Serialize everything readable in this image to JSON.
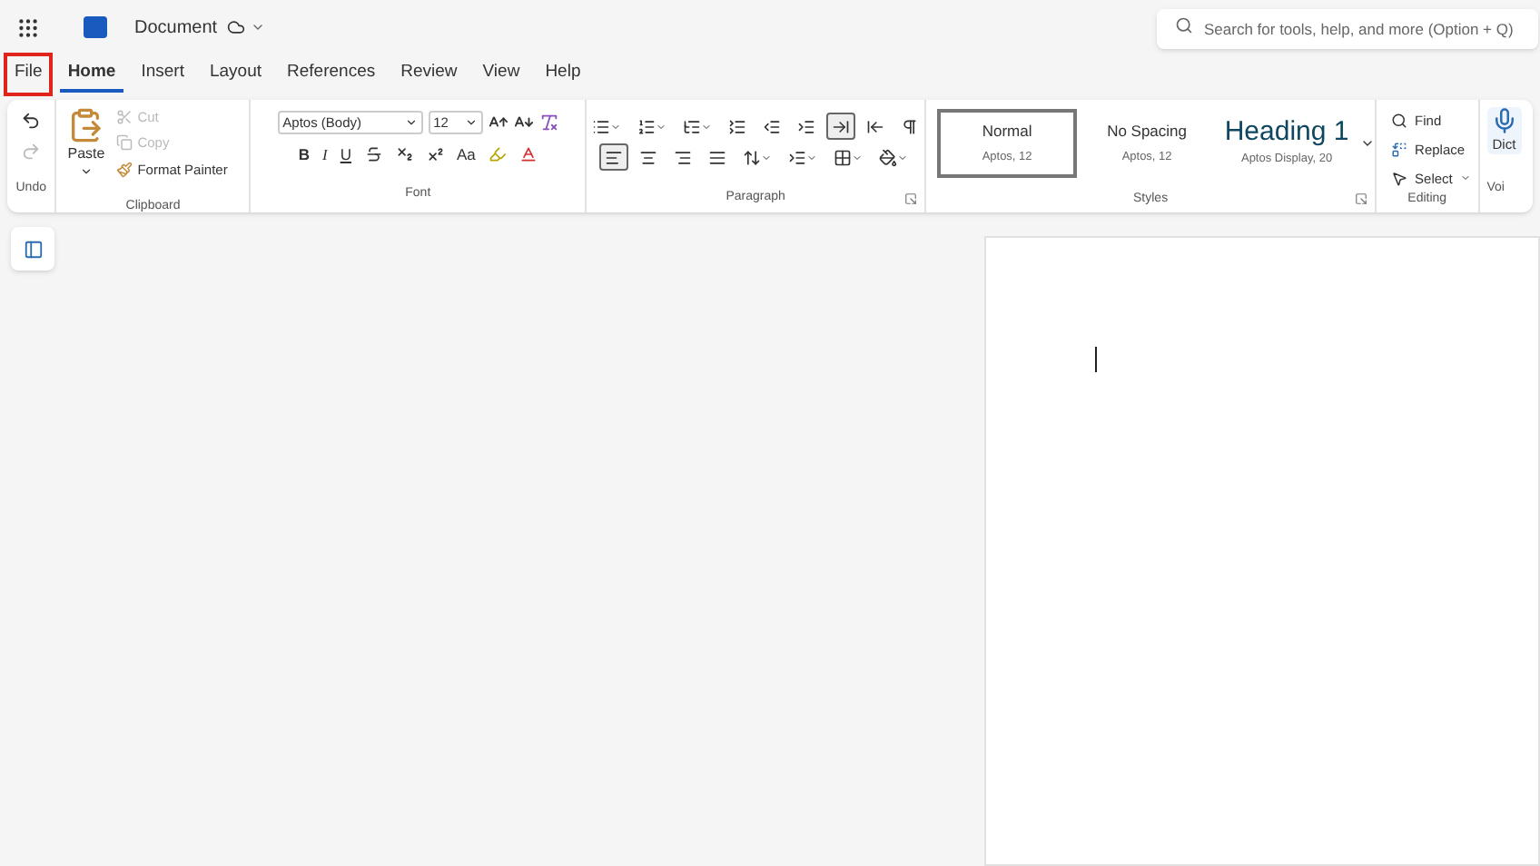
{
  "title_bar": {
    "document_title": "Document",
    "search": {
      "placeholder": "Search for tools, help, and more (Option + Q)"
    }
  },
  "tabs": [
    {
      "label": "File",
      "selected": false,
      "highlighted": true
    },
    {
      "label": "Home",
      "selected": true,
      "highlighted": false
    },
    {
      "label": "Insert",
      "selected": false,
      "highlighted": false
    },
    {
      "label": "Layout",
      "selected": false,
      "highlighted": false
    },
    {
      "label": "References",
      "selected": false,
      "highlighted": false
    },
    {
      "label": "Review",
      "selected": false,
      "highlighted": false
    },
    {
      "label": "View",
      "selected": false,
      "highlighted": false
    },
    {
      "label": "Help",
      "selected": false,
      "highlighted": false
    }
  ],
  "ribbon": {
    "undo": {
      "label": "Undo",
      "redo_disabled": true
    },
    "clipboard": {
      "label": "Clipboard",
      "paste": "Paste",
      "items": [
        {
          "kind": "cut",
          "label": "Cut",
          "disabled": true
        },
        {
          "kind": "copy",
          "label": "Copy",
          "disabled": true
        },
        {
          "kind": "painter",
          "label": "Format Painter",
          "disabled": false
        }
      ]
    },
    "font": {
      "label": "Font",
      "font_name": "Aptos (Body)",
      "font_size": "12",
      "buttons": [
        {
          "kind": "bold",
          "label": "B"
        },
        {
          "kind": "italic",
          "label": "I"
        },
        {
          "kind": "underline",
          "label": "U"
        },
        {
          "kind": "strike"
        },
        {
          "kind": "sub"
        },
        {
          "kind": "sup"
        },
        {
          "kind": "case",
          "label": "Aa"
        },
        {
          "kind": "highlight"
        },
        {
          "kind": "color"
        }
      ]
    },
    "paragraph": {
      "label": "Paragraph",
      "row_1": [
        {
          "kind": "bullets",
          "selected": false
        },
        {
          "kind": "numbering",
          "selected": false
        },
        {
          "kind": "multilevel",
          "selected": false
        },
        {
          "kind": "list",
          "selected": false
        },
        {
          "kind": "outdent",
          "selected": false
        },
        {
          "kind": "indent",
          "selected": false
        },
        {
          "kind": "ltr",
          "selected": true
        },
        {
          "kind": "rtl",
          "selected": false
        },
        {
          "kind": "marks",
          "selected": false
        }
      ],
      "row_2": [
        {
          "kind": "left",
          "selected": true
        },
        {
          "kind": "center",
          "selected": false
        },
        {
          "kind": "right",
          "selected": false
        },
        {
          "kind": "justify",
          "selected": false
        },
        {
          "kind": "spacing",
          "selected": false
        },
        {
          "kind": "para_spacing",
          "selected": false
        },
        {
          "kind": "borders",
          "selected": false
        },
        {
          "kind": "shading",
          "selected": false
        }
      ]
    },
    "styles": {
      "label": "Styles",
      "items": [
        {
          "name": "Normal",
          "description": "Aptos, 12",
          "selected": true,
          "kind": "normal"
        },
        {
          "name": "No Spacing",
          "description": "Aptos, 12",
          "selected": false,
          "kind": "normal"
        },
        {
          "name": "Heading 1",
          "description": "Aptos Display, 20",
          "selected": false,
          "kind": "heading"
        }
      ]
    },
    "editing": {
      "label": "Editing",
      "items": [
        {
          "kind": "find",
          "label": "Find"
        },
        {
          "kind": "replace",
          "label": "Replace"
        },
        {
          "kind": "select",
          "label": "Select"
        }
      ]
    },
    "voice": {
      "button": "Dict",
      "label": "Voi"
    }
  }
}
